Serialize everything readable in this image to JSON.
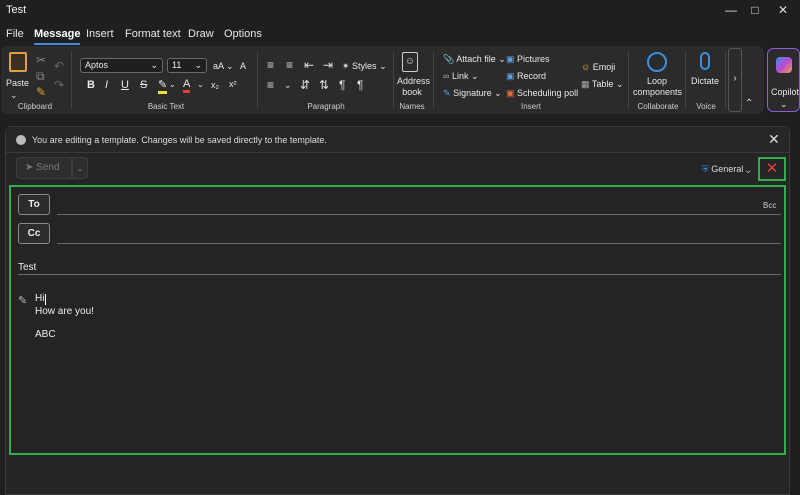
{
  "window": {
    "title": "Test"
  },
  "tabs": [
    "File",
    "Message",
    "Insert",
    "Format text",
    "Draw",
    "Options"
  ],
  "ribbon": {
    "clipboard": {
      "paste": "Paste",
      "label": "Clipboard"
    },
    "basic_text": {
      "font": "Aptos",
      "size": "11",
      "label": "Basic Text"
    },
    "paragraph": {
      "styles": "Styles",
      "label": "Paragraph"
    },
    "names": {
      "address_book": "Address book",
      "label": "Names"
    },
    "insert": {
      "attach": "Attach file",
      "link": "Link",
      "signature": "Signature",
      "pictures": "Pictures",
      "record": "Record",
      "scheduling": "Scheduling poll",
      "emoji": "Emoji",
      "table": "Table",
      "label": "Insert"
    },
    "collaborate": {
      "loop": "Loop components",
      "label": "Collaborate"
    },
    "voice": {
      "dictate": "Dictate",
      "label": "Voice"
    },
    "copilot": "Copilot"
  },
  "infobar": {
    "text": "You are editing a template. Changes will be saved directly to the template."
  },
  "compose": {
    "send": "Send",
    "sensitivity": "General",
    "to": "To",
    "cc": "Cc",
    "bcc": "Bcc",
    "subject": "Test",
    "body": [
      "Hi",
      "How are you!",
      "",
      "ABC"
    ]
  }
}
